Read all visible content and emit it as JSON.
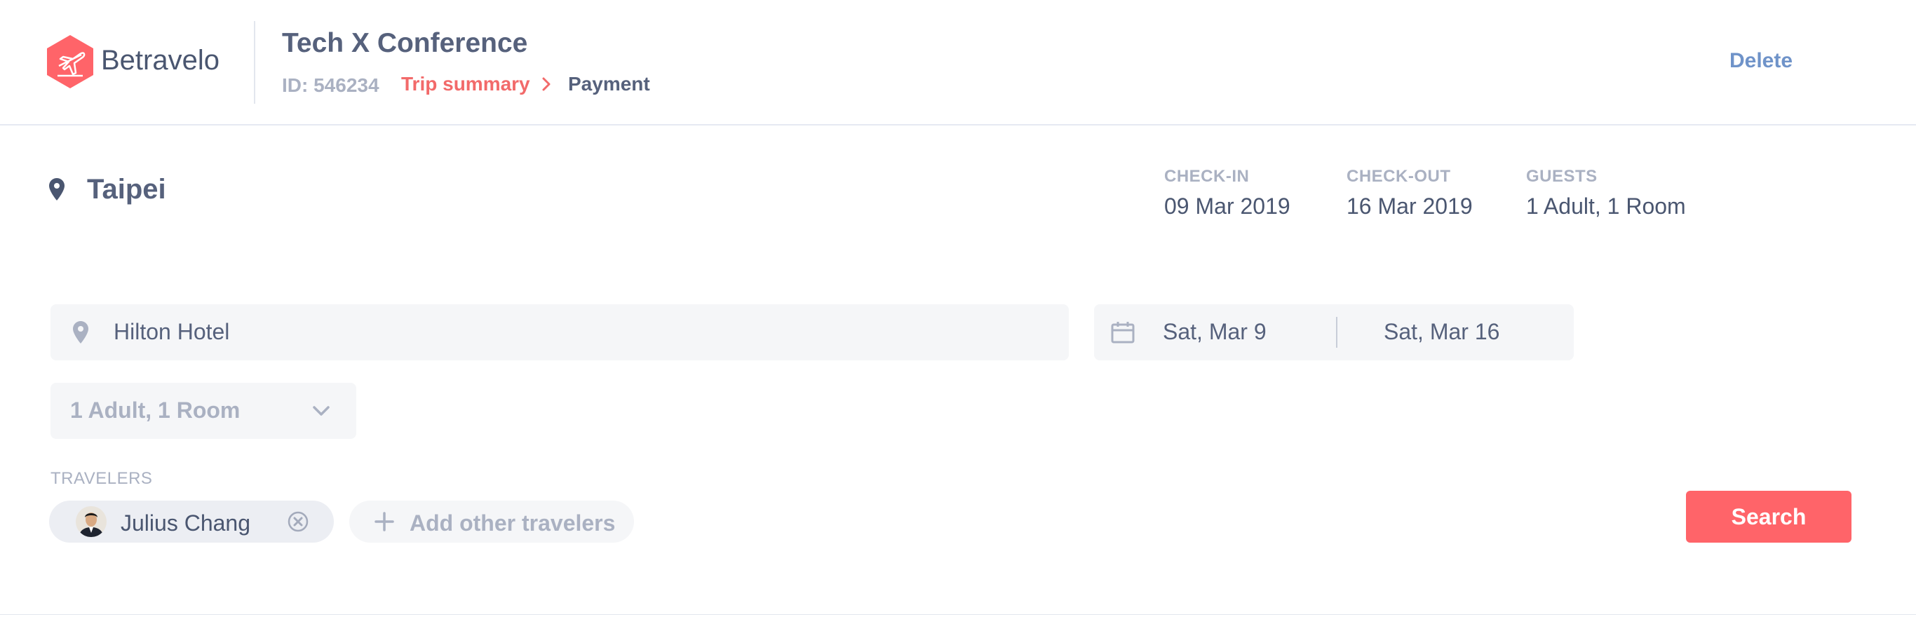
{
  "brand": {
    "name": "Betravelo",
    "accent_color": "#ff6469"
  },
  "header": {
    "title": "Tech X Conference",
    "trip_id": "ID: 546234",
    "breadcrumb": {
      "current_step": "Trip summary",
      "next_step": "Payment"
    },
    "delete_label": "Delete"
  },
  "summary": {
    "city": "Taipei",
    "check_in": {
      "label": "CHECK-IN",
      "value": "09 Mar 2019"
    },
    "check_out": {
      "label": "CHECK-OUT",
      "value": "16 Mar 2019"
    },
    "guests": {
      "label": "GUESTS",
      "value": "1 Adult, 1 Room"
    }
  },
  "form": {
    "hotel": "Hilton Hotel",
    "date_in": "Sat, Mar 9",
    "date_out": "Sat, Mar 16",
    "guests_select": "1 Adult, 1 Room",
    "travelers_label": "TRAVELERS",
    "travelers": [
      {
        "name": "Julius Chang"
      }
    ],
    "add_travelers_label": "Add other travelers",
    "search_label": "Search"
  },
  "icons": [
    "logo-plane-icon",
    "chevron-right-icon",
    "location-pin-icon",
    "calendar-icon",
    "chevron-down-icon",
    "remove-circle-icon",
    "plus-icon"
  ]
}
